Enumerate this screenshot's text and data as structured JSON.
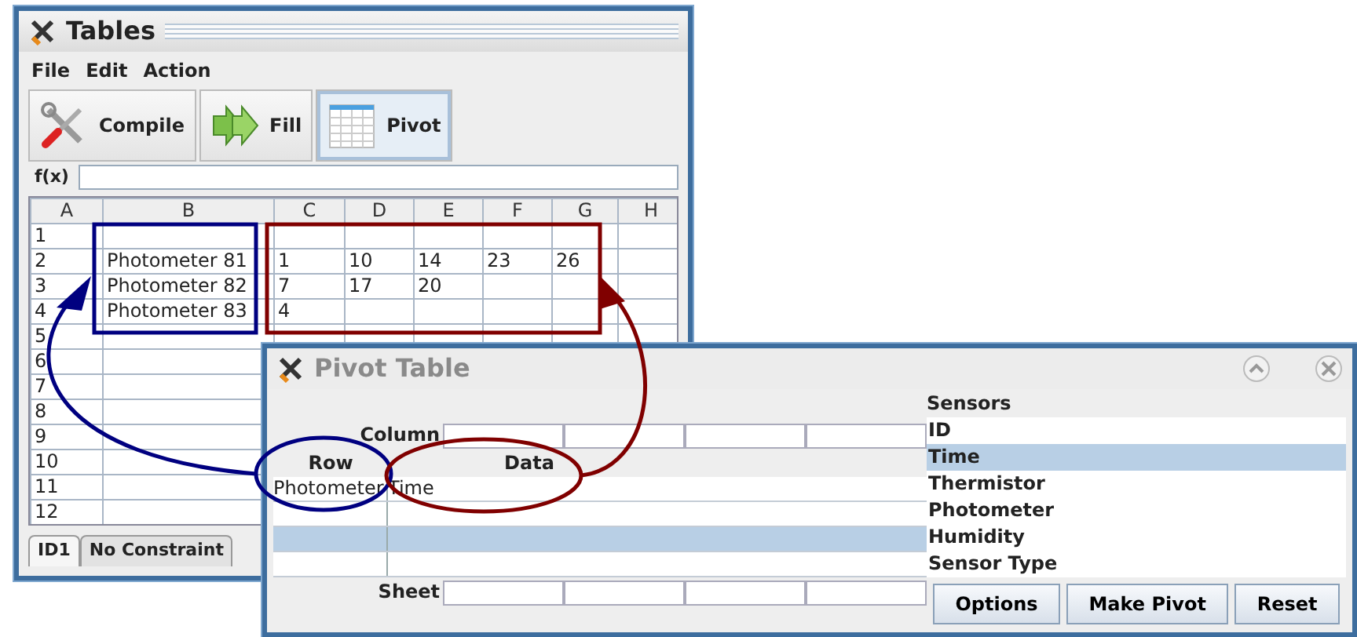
{
  "tables_window": {
    "title": "Tables",
    "menu": [
      "File",
      "Edit",
      "Action"
    ],
    "toolbar": [
      {
        "label": "Compile",
        "kind": "compile",
        "selected": false
      },
      {
        "label": "Fill",
        "kind": "fill",
        "selected": false
      },
      {
        "label": "Pivot",
        "kind": "pivot",
        "selected": true
      }
    ],
    "formula_label": "f(x)",
    "sheet": {
      "columns": [
        "A",
        "B",
        "C",
        "D",
        "E",
        "F",
        "G",
        "H"
      ],
      "rows": [
        {
          "cells": [
            "1"
          ]
        },
        {
          "cells": [
            "2",
            "Photometer 81",
            "1",
            "10",
            "14",
            "23",
            "26"
          ]
        },
        {
          "cells": [
            "3",
            "Photometer 82",
            "7",
            "17",
            "20"
          ]
        },
        {
          "cells": [
            "4",
            "Photometer 83",
            "4"
          ]
        },
        {
          "cells": [
            "5"
          ]
        },
        {
          "cells": [
            "6"
          ]
        },
        {
          "cells": [
            "7"
          ]
        },
        {
          "cells": [
            "8"
          ]
        },
        {
          "cells": [
            "9"
          ]
        },
        {
          "cells": [
            "10"
          ]
        },
        {
          "cells": [
            "11"
          ]
        },
        {
          "cells": [
            "12"
          ]
        }
      ]
    },
    "tabs": [
      {
        "label": "ID1",
        "selected": true
      },
      {
        "label": "No Constraint",
        "selected": false
      }
    ]
  },
  "pivot_window": {
    "title": "Pivot Table",
    "column_label": "Column",
    "row_header": "Row",
    "data_header": "Data",
    "rows": [
      {
        "row": "Photometer",
        "data": "Time",
        "selected": false
      },
      {
        "selected": false
      },
      {
        "selected": true
      },
      {
        "selected": false
      }
    ],
    "sheet_label": "Sheet",
    "sensors": {
      "title": "Sensors",
      "items": [
        {
          "label": "ID",
          "selected": false
        },
        {
          "label": "Time",
          "selected": true
        },
        {
          "label": "Thermistor",
          "selected": false
        },
        {
          "label": "Photometer",
          "selected": false
        },
        {
          "label": "Humidity",
          "selected": false
        },
        {
          "label": "Sensor Type",
          "selected": false
        }
      ]
    },
    "buttons": [
      "Options",
      "Make Pivot",
      "Reset"
    ]
  },
  "annotations": [
    {
      "kind": "rectangle",
      "color": "#000080"
    },
    {
      "kind": "rectangle",
      "color": "#800000"
    },
    {
      "kind": "ellipse",
      "color": "#000080"
    },
    {
      "kind": "ellipse",
      "color": "#800000"
    },
    {
      "kind": "arrow",
      "color": "#000080"
    },
    {
      "kind": "arrow",
      "color": "#800000"
    }
  ]
}
